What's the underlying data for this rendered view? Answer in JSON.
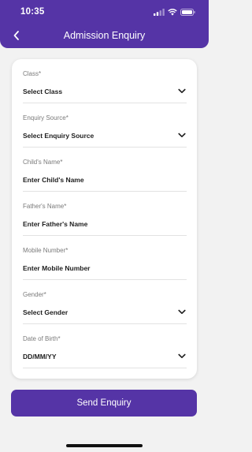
{
  "status_bar": {
    "time": "10:35"
  },
  "header": {
    "title": "Admission Enquiry"
  },
  "form": {
    "fields": [
      {
        "label": "Class*",
        "value": "Select Class",
        "type": "select"
      },
      {
        "label": "Enquiry Source*",
        "value": "Select Enquiry Source",
        "type": "select"
      },
      {
        "label": "Child's Name*",
        "value": "Enter Child's Name",
        "type": "text"
      },
      {
        "label": "Father's Name*",
        "value": "Enter Father's Name",
        "type": "text"
      },
      {
        "label": "Mobile Number*",
        "value": "Enter Mobile Number",
        "type": "text"
      },
      {
        "label": "Gender*",
        "value": "Select Gender",
        "type": "select"
      },
      {
        "label": "Date of Birth*",
        "value": "DD/MM/YY",
        "type": "select"
      }
    ]
  },
  "actions": {
    "send_label": "Send Enquiry"
  },
  "colors": {
    "primary": "#5534a6",
    "background": "#f2f2f2"
  }
}
